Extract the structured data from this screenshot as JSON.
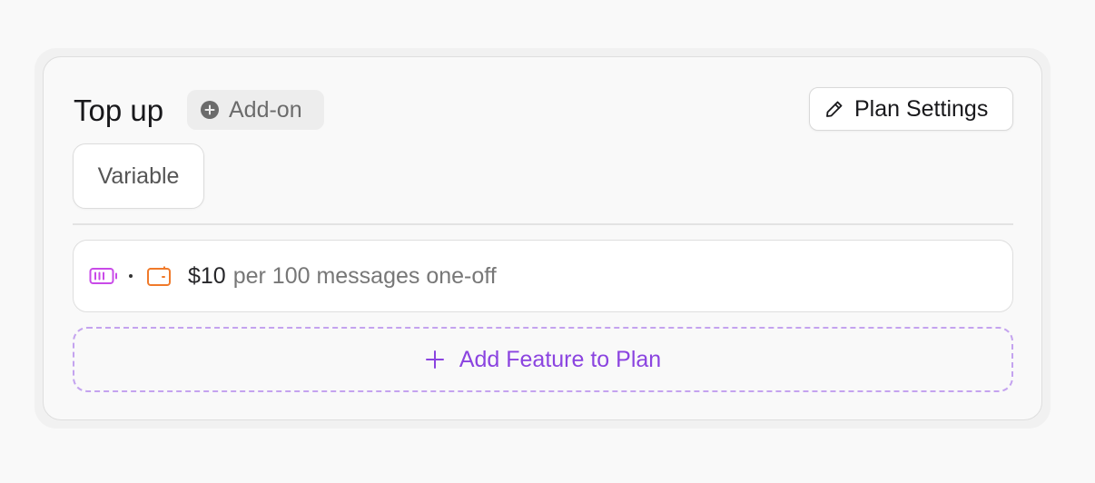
{
  "plan": {
    "title": "Top up",
    "badge": {
      "label": "Add-on",
      "icon": "plus-circle-icon"
    },
    "settings_button": {
      "label": "Plan Settings",
      "icon": "pencil-icon"
    },
    "price_type_chip": "Variable"
  },
  "feature": {
    "icons": [
      "battery-icon",
      "wallet-icon"
    ],
    "price": "$10",
    "description": "per 100 messages one-off"
  },
  "add_feature_button": {
    "label": "Add Feature to Plan",
    "icon": "plus-icon"
  },
  "colors": {
    "accent_purple": "#8b44e0",
    "battery_icon": "#c94ae8",
    "wallet_icon": "#f07a2a"
  }
}
